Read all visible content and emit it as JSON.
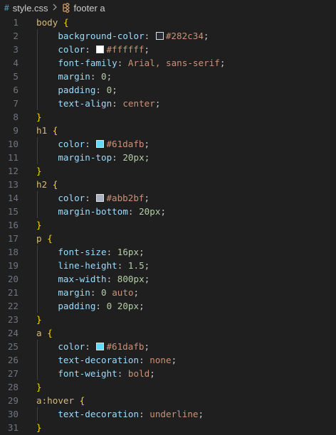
{
  "breadcrumb": {
    "file_icon": "hash-icon",
    "file_name": "style.css",
    "separator_icon": "chevron-right-icon",
    "symbol_icon": "css-rule-icon",
    "symbol_name": "footer a"
  },
  "lines": [
    {
      "n": "1",
      "tokens": [
        {
          "t": "body",
          "c": "sel"
        },
        {
          "t": " ",
          "c": "punc"
        },
        {
          "t": "{",
          "c": "brace"
        }
      ]
    },
    {
      "n": "2",
      "tokens": [
        {
          "t": "    ",
          "c": "punc"
        },
        {
          "t": "background-color",
          "c": "prop"
        },
        {
          "t": ": ",
          "c": "punc"
        },
        {
          "swatch": "#282c34"
        },
        {
          "t": "#282c34",
          "c": "str"
        },
        {
          "t": ";",
          "c": "punc"
        }
      ]
    },
    {
      "n": "3",
      "tokens": [
        {
          "t": "    ",
          "c": "punc"
        },
        {
          "t": "color",
          "c": "prop"
        },
        {
          "t": ": ",
          "c": "punc"
        },
        {
          "swatch": "#ffffff"
        },
        {
          "t": "#ffffff",
          "c": "str"
        },
        {
          "t": ";",
          "c": "punc"
        }
      ]
    },
    {
      "n": "4",
      "tokens": [
        {
          "t": "    ",
          "c": "punc"
        },
        {
          "t": "font-family",
          "c": "prop"
        },
        {
          "t": ": ",
          "c": "punc"
        },
        {
          "t": "Arial, sans-serif",
          "c": "str"
        },
        {
          "t": ";",
          "c": "punc"
        }
      ]
    },
    {
      "n": "5",
      "tokens": [
        {
          "t": "    ",
          "c": "punc"
        },
        {
          "t": "margin",
          "c": "prop"
        },
        {
          "t": ": ",
          "c": "punc"
        },
        {
          "t": "0",
          "c": "num"
        },
        {
          "t": ";",
          "c": "punc"
        }
      ]
    },
    {
      "n": "6",
      "tokens": [
        {
          "t": "    ",
          "c": "punc"
        },
        {
          "t": "padding",
          "c": "prop"
        },
        {
          "t": ": ",
          "c": "punc"
        },
        {
          "t": "0",
          "c": "num"
        },
        {
          "t": ";",
          "c": "punc"
        }
      ]
    },
    {
      "n": "7",
      "tokens": [
        {
          "t": "    ",
          "c": "punc"
        },
        {
          "t": "text-align",
          "c": "prop"
        },
        {
          "t": ": ",
          "c": "punc"
        },
        {
          "t": "center",
          "c": "str"
        },
        {
          "t": ";",
          "c": "punc"
        }
      ]
    },
    {
      "n": "8",
      "tokens": [
        {
          "t": "}",
          "c": "brace"
        }
      ]
    },
    {
      "n": "9",
      "tokens": [
        {
          "t": "h1",
          "c": "sel"
        },
        {
          "t": " ",
          "c": "punc"
        },
        {
          "t": "{",
          "c": "brace"
        }
      ]
    },
    {
      "n": "10",
      "tokens": [
        {
          "t": "    ",
          "c": "punc"
        },
        {
          "t": "color",
          "c": "prop"
        },
        {
          "t": ": ",
          "c": "punc"
        },
        {
          "swatch": "#61dafb"
        },
        {
          "t": "#61dafb",
          "c": "str"
        },
        {
          "t": ";",
          "c": "punc"
        }
      ]
    },
    {
      "n": "11",
      "tokens": [
        {
          "t": "    ",
          "c": "punc"
        },
        {
          "t": "margin-top",
          "c": "prop"
        },
        {
          "t": ": ",
          "c": "punc"
        },
        {
          "t": "20px",
          "c": "num"
        },
        {
          "t": ";",
          "c": "punc"
        }
      ]
    },
    {
      "n": "12",
      "tokens": [
        {
          "t": "}",
          "c": "brace"
        }
      ]
    },
    {
      "n": "13",
      "tokens": [
        {
          "t": "h2",
          "c": "sel"
        },
        {
          "t": " ",
          "c": "punc"
        },
        {
          "t": "{",
          "c": "brace"
        }
      ]
    },
    {
      "n": "14",
      "tokens": [
        {
          "t": "    ",
          "c": "punc"
        },
        {
          "t": "color",
          "c": "prop"
        },
        {
          "t": ": ",
          "c": "punc"
        },
        {
          "swatch": "#abb2bf"
        },
        {
          "t": "#abb2bf",
          "c": "str"
        },
        {
          "t": ";",
          "c": "punc"
        }
      ]
    },
    {
      "n": "15",
      "tokens": [
        {
          "t": "    ",
          "c": "punc"
        },
        {
          "t": "margin-bottom",
          "c": "prop"
        },
        {
          "t": ": ",
          "c": "punc"
        },
        {
          "t": "20px",
          "c": "num"
        },
        {
          "t": ";",
          "c": "punc"
        }
      ]
    },
    {
      "n": "16",
      "tokens": [
        {
          "t": "}",
          "c": "brace"
        }
      ]
    },
    {
      "n": "17",
      "tokens": [
        {
          "t": "p",
          "c": "sel"
        },
        {
          "t": " ",
          "c": "punc"
        },
        {
          "t": "{",
          "c": "brace"
        }
      ]
    },
    {
      "n": "18",
      "tokens": [
        {
          "t": "    ",
          "c": "punc"
        },
        {
          "t": "font-size",
          "c": "prop"
        },
        {
          "t": ": ",
          "c": "punc"
        },
        {
          "t": "16px",
          "c": "num"
        },
        {
          "t": ";",
          "c": "punc"
        }
      ]
    },
    {
      "n": "19",
      "tokens": [
        {
          "t": "    ",
          "c": "punc"
        },
        {
          "t": "line-height",
          "c": "prop"
        },
        {
          "t": ": ",
          "c": "punc"
        },
        {
          "t": "1.5",
          "c": "num"
        },
        {
          "t": ";",
          "c": "punc"
        }
      ]
    },
    {
      "n": "20",
      "tokens": [
        {
          "t": "    ",
          "c": "punc"
        },
        {
          "t": "max-width",
          "c": "prop"
        },
        {
          "t": ": ",
          "c": "punc"
        },
        {
          "t": "800px",
          "c": "num"
        },
        {
          "t": ";",
          "c": "punc"
        }
      ]
    },
    {
      "n": "21",
      "tokens": [
        {
          "t": "    ",
          "c": "punc"
        },
        {
          "t": "margin",
          "c": "prop"
        },
        {
          "t": ": ",
          "c": "punc"
        },
        {
          "t": "0",
          "c": "num"
        },
        {
          "t": " ",
          "c": "punc"
        },
        {
          "t": "auto",
          "c": "str"
        },
        {
          "t": ";",
          "c": "punc"
        }
      ]
    },
    {
      "n": "22",
      "tokens": [
        {
          "t": "    ",
          "c": "punc"
        },
        {
          "t": "padding",
          "c": "prop"
        },
        {
          "t": ": ",
          "c": "punc"
        },
        {
          "t": "0 20px",
          "c": "num"
        },
        {
          "t": ";",
          "c": "punc"
        }
      ]
    },
    {
      "n": "23",
      "tokens": [
        {
          "t": "}",
          "c": "brace"
        }
      ]
    },
    {
      "n": "24",
      "tokens": [
        {
          "t": "a",
          "c": "sel"
        },
        {
          "t": " ",
          "c": "punc"
        },
        {
          "t": "{",
          "c": "brace"
        }
      ]
    },
    {
      "n": "25",
      "tokens": [
        {
          "t": "    ",
          "c": "punc"
        },
        {
          "t": "color",
          "c": "prop"
        },
        {
          "t": ": ",
          "c": "punc"
        },
        {
          "swatch": "#61dafb"
        },
        {
          "t": "#61dafb",
          "c": "str"
        },
        {
          "t": ";",
          "c": "punc"
        }
      ]
    },
    {
      "n": "26",
      "tokens": [
        {
          "t": "    ",
          "c": "punc"
        },
        {
          "t": "text-decoration",
          "c": "prop"
        },
        {
          "t": ": ",
          "c": "punc"
        },
        {
          "t": "none",
          "c": "str"
        },
        {
          "t": ";",
          "c": "punc"
        }
      ]
    },
    {
      "n": "27",
      "tokens": [
        {
          "t": "    ",
          "c": "punc"
        },
        {
          "t": "font-weight",
          "c": "prop"
        },
        {
          "t": ": ",
          "c": "punc"
        },
        {
          "t": "bold",
          "c": "str"
        },
        {
          "t": ";",
          "c": "punc"
        }
      ]
    },
    {
      "n": "28",
      "tokens": [
        {
          "t": "}",
          "c": "brace"
        }
      ]
    },
    {
      "n": "29",
      "tokens": [
        {
          "t": "a:hover",
          "c": "sel"
        },
        {
          "t": " ",
          "c": "punc"
        },
        {
          "t": "{",
          "c": "brace"
        }
      ]
    },
    {
      "n": "30",
      "tokens": [
        {
          "t": "    ",
          "c": "punc"
        },
        {
          "t": "text-decoration",
          "c": "prop"
        },
        {
          "t": ": ",
          "c": "punc"
        },
        {
          "t": "underline",
          "c": "str"
        },
        {
          "t": ";",
          "c": "punc"
        }
      ]
    },
    {
      "n": "31",
      "tokens": [
        {
          "t": "}",
          "c": "brace"
        }
      ]
    }
  ]
}
